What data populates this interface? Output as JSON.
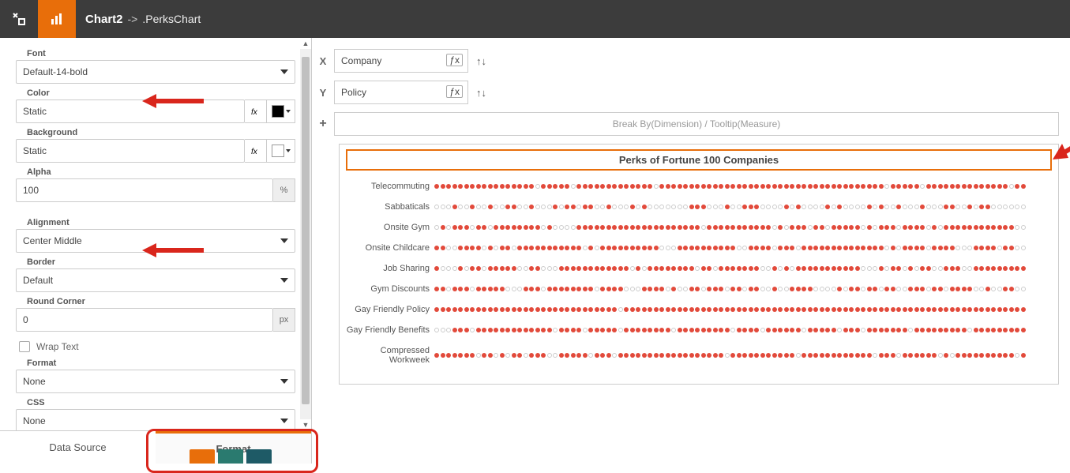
{
  "header": {
    "title": "Chart2",
    "arrow": "->",
    "subtitle": ".PerksChart"
  },
  "form": {
    "font": {
      "label": "Font",
      "value": "Default-14-bold"
    },
    "color": {
      "label": "Color",
      "value": "Static"
    },
    "background": {
      "label": "Background",
      "value": "Static"
    },
    "alpha": {
      "label": "Alpha",
      "value": "100",
      "unit": "%"
    },
    "alignment": {
      "label": "Alignment",
      "value": "Center Middle"
    },
    "border": {
      "label": "Border",
      "value": "Default"
    },
    "roundcorner": {
      "label": "Round Corner",
      "value": "0",
      "unit": "px"
    },
    "wraptext": {
      "label": "Wrap Text"
    },
    "format": {
      "label": "Format",
      "value": "None"
    },
    "css": {
      "label": "CSS",
      "value": "None"
    }
  },
  "tabs": {
    "datasource": "Data Source",
    "format": "Format"
  },
  "axes": {
    "x": {
      "label": "X",
      "value": "Company"
    },
    "y": {
      "label": "Y",
      "value": "Policy"
    },
    "plus": "+",
    "breakby": "Break By(Dimension) / Tooltip(Measure)"
  },
  "chart_data": {
    "type": "dotmatrix",
    "title": "Perks of Fortune 100 Companies",
    "xlabel": "Company",
    "ylabel": "Policy",
    "categories": [
      "Telecommuting",
      "Sabbaticals",
      "Onsite Gym",
      "Onsite Childcare",
      "Job Sharing",
      "Gym Discounts",
      "Gay Friendly Policy",
      "Gay Friendly Benefits",
      "Compressed Workweek"
    ],
    "n_companies": 100,
    "density": {
      "Telecommuting": 0.92,
      "Sabbaticals": 0.4,
      "Onsite Gym": 0.8,
      "Onsite Childcare": 0.78,
      "Job Sharing": 0.7,
      "Gym Discounts": 0.7,
      "Gay Friendly Policy": 0.98,
      "Gay Friendly Benefits": 0.85,
      "Compressed Workweek": 0.88
    }
  }
}
